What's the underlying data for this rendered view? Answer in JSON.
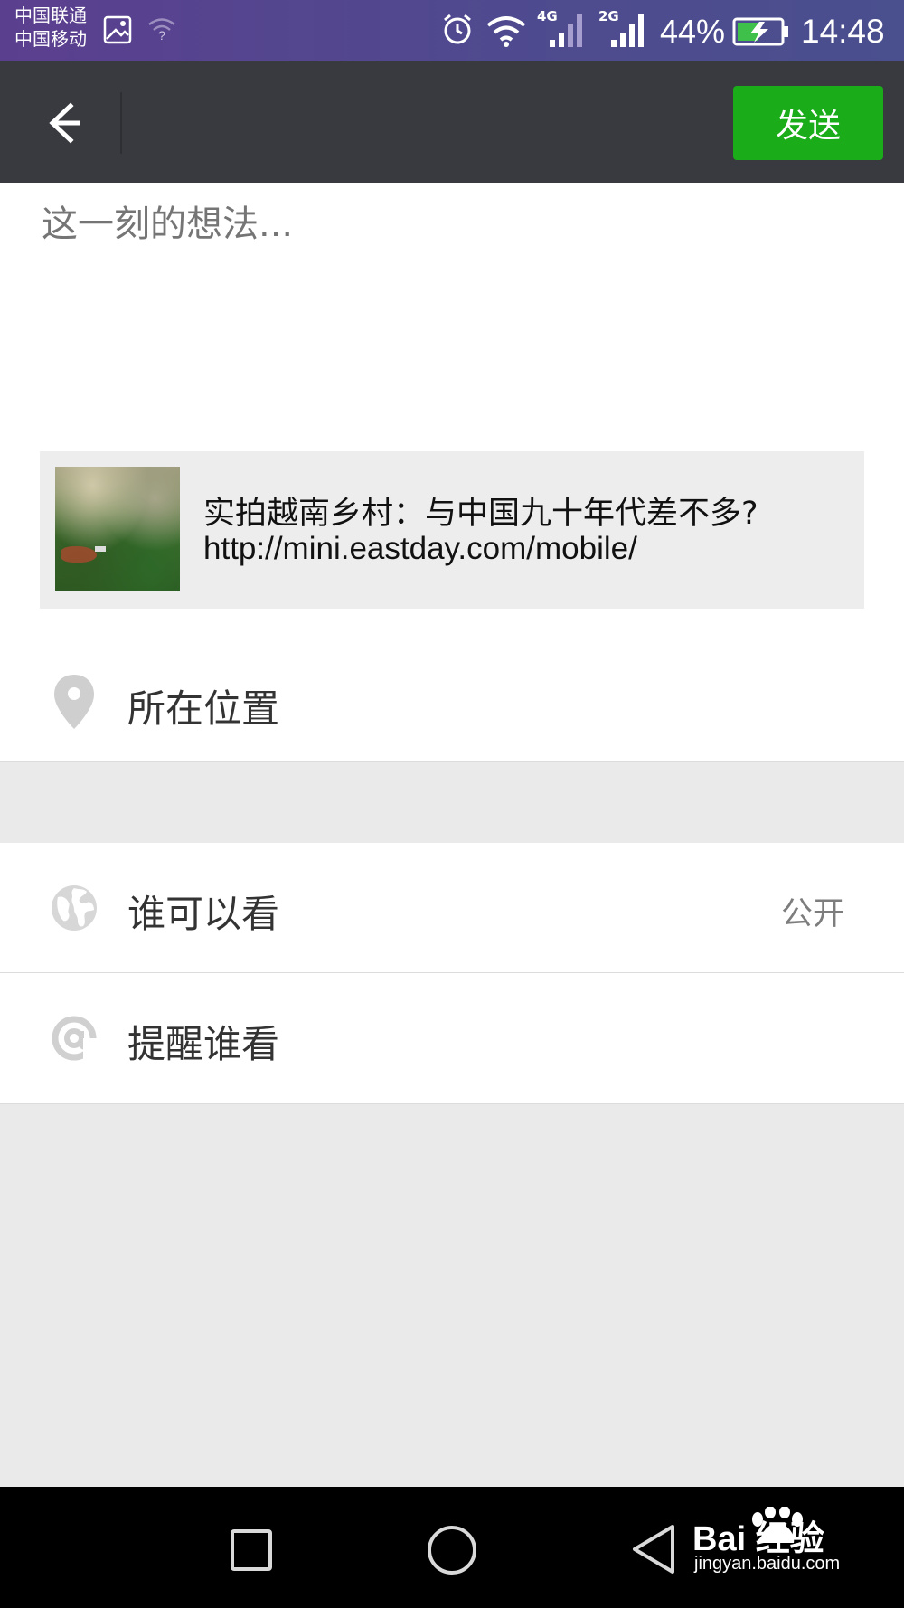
{
  "status_bar": {
    "carrier_1": "中国联通",
    "carrier_2": "中国移动",
    "network_1": "4G",
    "network_2": "2G",
    "battery": "44%",
    "time": "14:48",
    "icons": [
      "gallery-icon",
      "wifi-question-icon",
      "alarm-icon",
      "wifi-icon",
      "signal-icon",
      "battery-charging-icon"
    ]
  },
  "nav": {
    "back_icon": "arrow-left-icon",
    "send_label": "发送",
    "send_color": "#1aad19"
  },
  "compose": {
    "placeholder": "这一刻的想法..."
  },
  "link_card": {
    "title": "实拍越南乡村：与中国九十年代差不多?",
    "url": "http://mini.eastday.com/mobile/"
  },
  "location": {
    "icon": "location-pin-icon",
    "label": "所在位置"
  },
  "visibility": {
    "icon": "globe-icon",
    "label": "谁可以看",
    "value": "公开"
  },
  "mention": {
    "icon": "at-icon",
    "label": "提醒谁看"
  },
  "system_nav": {
    "icons": [
      "recent-apps-icon",
      "home-icon",
      "back-triangle-icon"
    ],
    "watermark_brand": "Bai 经验",
    "watermark_url": "jingyan.baidu.com"
  }
}
